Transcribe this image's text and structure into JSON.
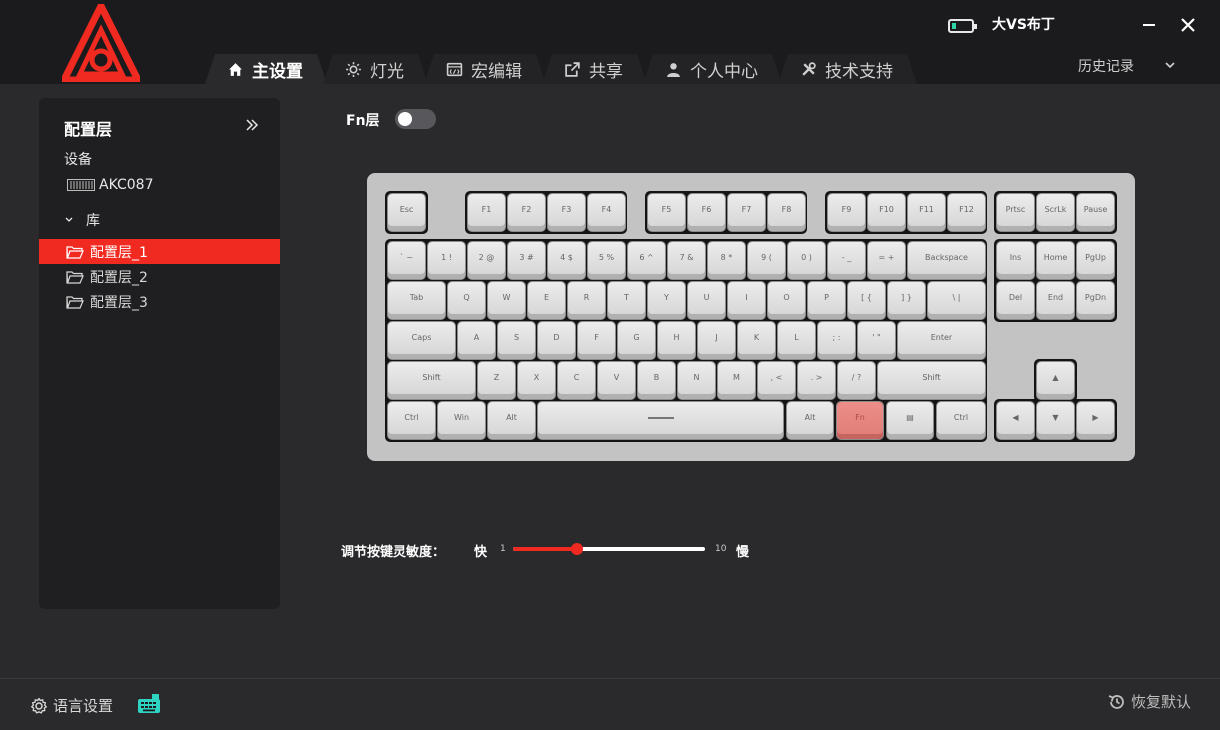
{
  "header": {
    "username": "大VS布丁",
    "battery_level": 0.2,
    "history_label": "历史记录",
    "accent": "#f02a20"
  },
  "tabs": [
    {
      "label": "主设置",
      "icon": "home-icon",
      "active": true
    },
    {
      "label": "灯光",
      "icon": "sun-icon",
      "active": false
    },
    {
      "label": "宏编辑",
      "icon": "macro-icon",
      "active": false
    },
    {
      "label": "共享",
      "icon": "share-icon",
      "active": false
    },
    {
      "label": "个人中心",
      "icon": "user-icon",
      "active": false
    },
    {
      "label": "技术支持",
      "icon": "tools-icon",
      "active": false
    }
  ],
  "sidebar": {
    "title": "配置层",
    "device_label": "设备",
    "device_name": "AKC087",
    "library_label": "库",
    "layers": [
      {
        "label": "配置层_1",
        "active": true
      },
      {
        "label": "配置层_2",
        "active": false
      },
      {
        "label": "配置层_3",
        "active": false
      }
    ]
  },
  "main": {
    "fn_label": "Fn层",
    "fn_enabled": false,
    "keys": {
      "esc": "Esc",
      "f1": "F1",
      "f2": "F2",
      "f3": "F3",
      "f4": "F4",
      "f5": "F5",
      "f6": "F6",
      "f7": "F7",
      "f8": "F8",
      "f9": "F9",
      "f10": "F10",
      "f11": "F11",
      "f12": "F12",
      "prtsc": "Prtsc",
      "scrlk": "ScrLk",
      "pause": "Pause",
      "grave": "` ~",
      "n1": "1 !",
      "n2": "2 @",
      "n3": "3 #",
      "n4": "4 $",
      "n5": "5 %",
      "n6": "6 ^",
      "n7": "7 &",
      "n8": "8 *",
      "n9": "9 (",
      "n0": "0 )",
      "minus": "- _",
      "equal": "= +",
      "backspace": "Backspace",
      "ins": "Ins",
      "home": "Home",
      "pgup": "PgUp",
      "tab": "Tab",
      "q": "Q",
      "w": "W",
      "e": "E",
      "r": "R",
      "t": "T",
      "y": "Y",
      "u": "U",
      "i": "I",
      "o": "O",
      "p": "P",
      "lbracket": "[ {",
      "rbracket": "] }",
      "backslash": "\\ |",
      "del": "Del",
      "end": "End",
      "pgdn": "PgDn",
      "caps": "Caps",
      "a": "A",
      "s": "S",
      "d": "D",
      "f": "F",
      "g": "G",
      "h": "H",
      "j": "J",
      "k": "K",
      "l": "L",
      "semicolon": "; :",
      "quote": "' \"",
      "enter": "Enter",
      "lshift": "Shift",
      "z": "Z",
      "x": "X",
      "c": "C",
      "v": "V",
      "b": "B",
      "n": "N",
      "m": "M",
      "comma": ", <",
      "period": ". >",
      "slash": "/ ?",
      "rshift": "Shift",
      "up": "▲",
      "lctrl": "Ctrl",
      "win": "Win",
      "lalt": "Alt",
      "space": "",
      "ralt": "Alt",
      "fn": "Fn",
      "menu": "▤",
      "rctrl": "Ctrl",
      "left": "◀",
      "down": "▼",
      "right": "▶"
    },
    "sensitivity_label": "调节按键灵敏度：",
    "fast_label": "快",
    "slow_label": "慢",
    "min_label": "1",
    "max_label": "10",
    "sensitivity_value": 4
  },
  "footer": {
    "language_label": "语言设置",
    "restore_label": "恢复默认"
  }
}
